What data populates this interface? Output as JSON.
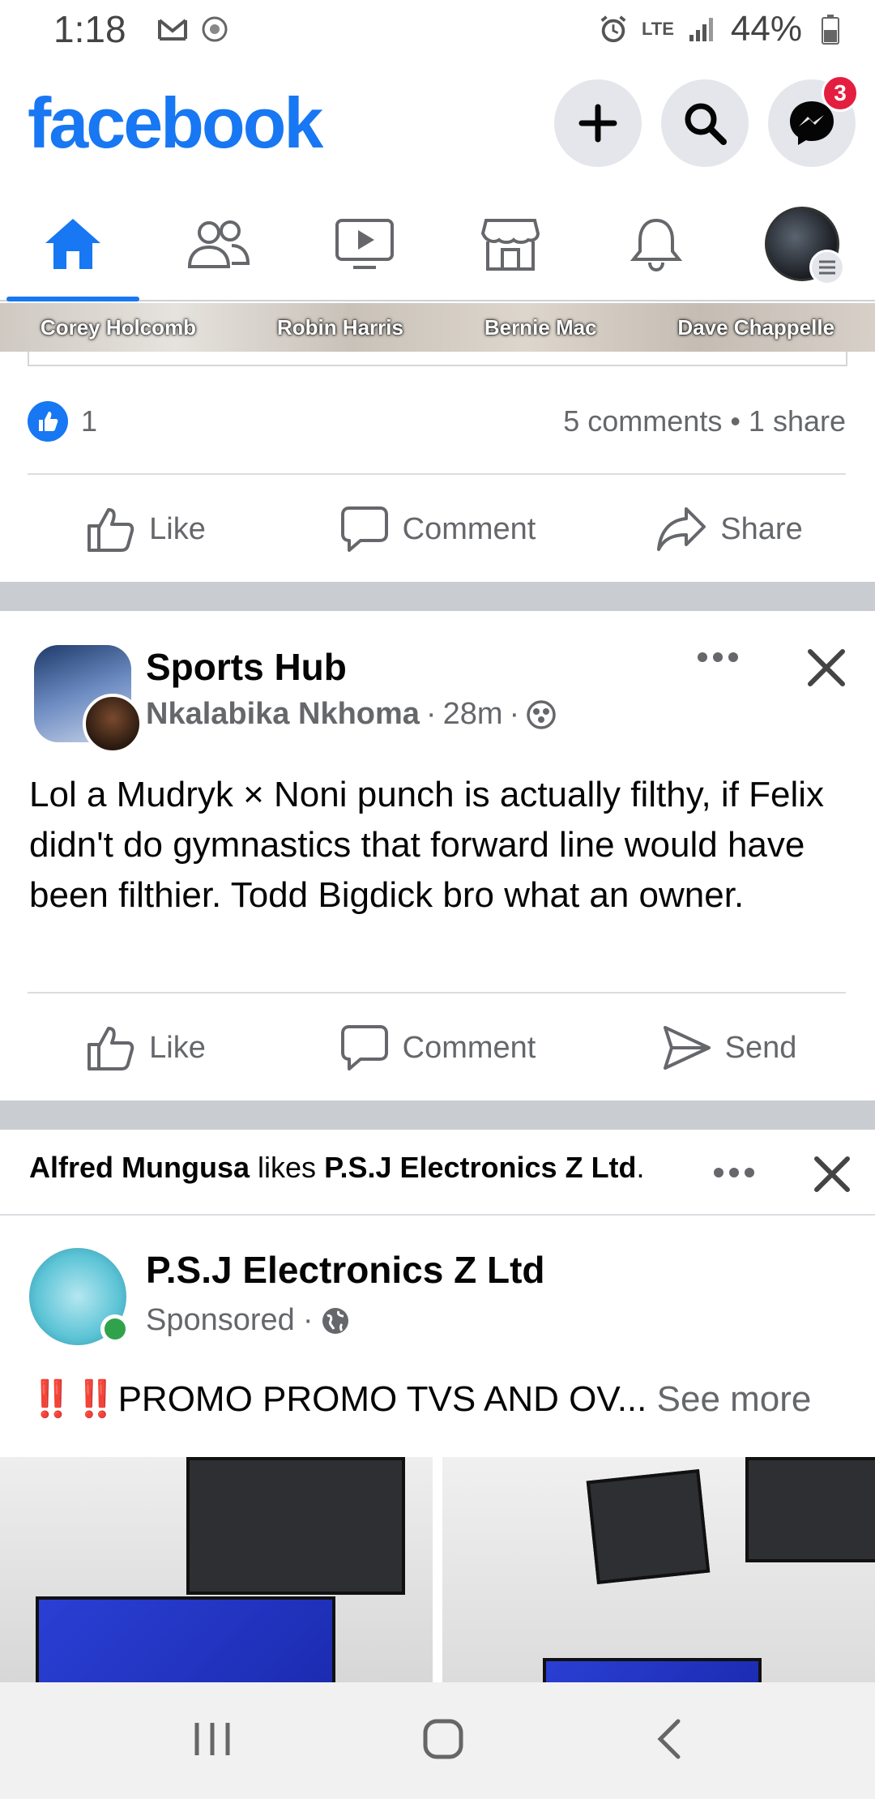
{
  "status_bar": {
    "time": "1:18",
    "network": "LTE",
    "battery": "44%"
  },
  "header": {
    "logo": "facebook",
    "messenger_badge": "3"
  },
  "tabs": [
    {
      "name": "home",
      "active": true
    },
    {
      "name": "friends",
      "active": false
    },
    {
      "name": "watch",
      "active": false
    },
    {
      "name": "marketplace",
      "active": false
    },
    {
      "name": "notifications",
      "active": false
    },
    {
      "name": "menu",
      "active": false
    }
  ],
  "strip": {
    "names": [
      "Corey Holcomb",
      "Robin Harris",
      "Bernie Mac",
      "Dave Chappelle"
    ]
  },
  "post0": {
    "reaction_count": "1",
    "meta": "5 comments • 1 share",
    "actions": [
      "Like",
      "Comment",
      "Share"
    ]
  },
  "post1": {
    "page_name": "Sports Hub",
    "author": "Nkalabika Nkhoma",
    "time": "28m",
    "text": "Lol  a Mudryk × Noni punch is actually filthy, if Felix didn't do gymnastics that forward line would have been filthier. Todd Bigdick bro what an owner.",
    "actions": [
      "Like",
      "Comment",
      "Send"
    ]
  },
  "post2": {
    "liker": "Alfred Mungusa",
    "liked_word": "likes",
    "liked_page": "P.S.J Electronics Z Ltd",
    "page_name": "P.S.J Electronics Z Ltd",
    "sponsored": "Sponsored",
    "bangs": "‼️‼️",
    "promo_text": "PROMO PROMO TVS AND OV...",
    "see_more": "See more"
  }
}
